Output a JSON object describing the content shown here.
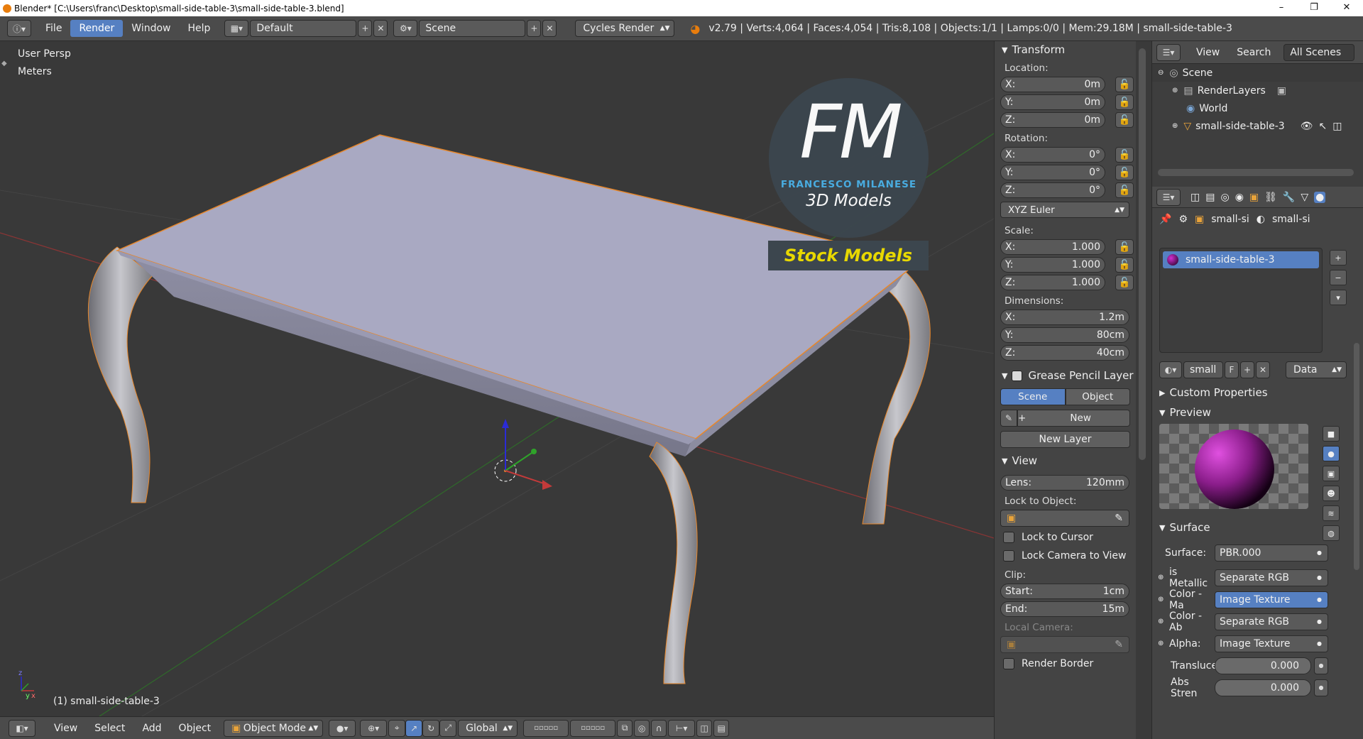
{
  "window": {
    "title": "Blender* [C:\\Users\\franc\\Desktop\\small-side-table-3\\small-side-table-3.blend]",
    "controls": [
      "–",
      "❐",
      "✕"
    ]
  },
  "topbar": {
    "menus": [
      "File",
      "Render",
      "Window",
      "Help"
    ],
    "active_menu": "Render",
    "layout": "Default",
    "scene": "Scene",
    "engine": "Cycles Render",
    "stats": "v2.79 | Verts:4,064 | Faces:4,054 | Tris:8,108 | Objects:1/1 | Lamps:0/0 | Mem:29.18M | small-side-table-3"
  },
  "viewport": {
    "view_name": "User Persp",
    "units": "Meters",
    "object_label": "(1) small-side-table-3",
    "logo": {
      "big": "FM",
      "company": "FRANCESCO MILANESE",
      "tagline": "3D Models",
      "banner": "Stock Models"
    }
  },
  "bottombar": {
    "menus": [
      "View",
      "Select",
      "Add",
      "Object"
    ],
    "mode": "Object Mode",
    "orientation": "Global"
  },
  "transform": {
    "title": "Transform",
    "location_label": "Location:",
    "location": [
      {
        "axis": "X:",
        "value": "0m"
      },
      {
        "axis": "Y:",
        "value": "0m"
      },
      {
        "axis": "Z:",
        "value": "0m"
      }
    ],
    "rotation_label": "Rotation:",
    "rotation": [
      {
        "axis": "X:",
        "value": "0°"
      },
      {
        "axis": "Y:",
        "value": "0°"
      },
      {
        "axis": "Z:",
        "value": "0°"
      }
    ],
    "rotation_mode": "XYZ Euler",
    "scale_label": "Scale:",
    "scale": [
      {
        "axis": "X:",
        "value": "1.000"
      },
      {
        "axis": "Y:",
        "value": "1.000"
      },
      {
        "axis": "Z:",
        "value": "1.000"
      }
    ],
    "dimensions_label": "Dimensions:",
    "dimensions": [
      {
        "axis": "X:",
        "value": "1.2m"
      },
      {
        "axis": "Y:",
        "value": "80cm"
      },
      {
        "axis": "Z:",
        "value": "40cm"
      }
    ]
  },
  "grease_pencil": {
    "title": "Grease Pencil Layer",
    "tab_scene": "Scene",
    "tab_object": "Object",
    "new_label": "New",
    "new_layer_label": "New Layer"
  },
  "view_panel": {
    "title": "View",
    "lens_label": "Lens:",
    "lens_value": "120mm",
    "lock_to_object": "Lock to Object:",
    "lock_to_cursor": "Lock to Cursor",
    "lock_camera": "Lock Camera to View",
    "clip_label": "Clip:",
    "clip_start_label": "Start:",
    "clip_start": "1cm",
    "clip_end_label": "End:",
    "clip_end": "15m",
    "local_camera": "Local Camera:",
    "render_border": "Render Border"
  },
  "outliner": {
    "menus": [
      "View",
      "Search"
    ],
    "filter": "All Scenes",
    "items": [
      "Scene",
      "RenderLayers",
      "World",
      "small-side-table-3"
    ]
  },
  "properties": {
    "breadcrumb": [
      "small-si",
      "small-si"
    ],
    "material_slot": "small-side-table-3",
    "material_name": "small",
    "fake_user": "F",
    "link": "Data",
    "custom_props": "Custom Properties",
    "preview": "Preview",
    "surface_title": "Surface",
    "surface_label": "Surface:",
    "surface_value": "PBR.000",
    "inputs": [
      {
        "label": "is Metallic",
        "value": "Separate RGB",
        "selected": false
      },
      {
        "label": "Color - Ma",
        "value": "Image Texture",
        "selected": true
      },
      {
        "label": "Color - Ab",
        "value": "Separate RGB",
        "selected": false
      },
      {
        "label": "Alpha:",
        "value": "Image Texture",
        "selected": false
      }
    ],
    "translucence_label": "Transluce",
    "translucence_value": "0.000",
    "abs_strength_label": "Abs Stren",
    "abs_strength_value": "0.000"
  },
  "colors": {
    "accent": "#5680c2",
    "selection_orange": "#e8872a",
    "axis_red": "#c43a3a",
    "axis_green": "#3a8f2e",
    "table_top": "#a9a9c2"
  }
}
